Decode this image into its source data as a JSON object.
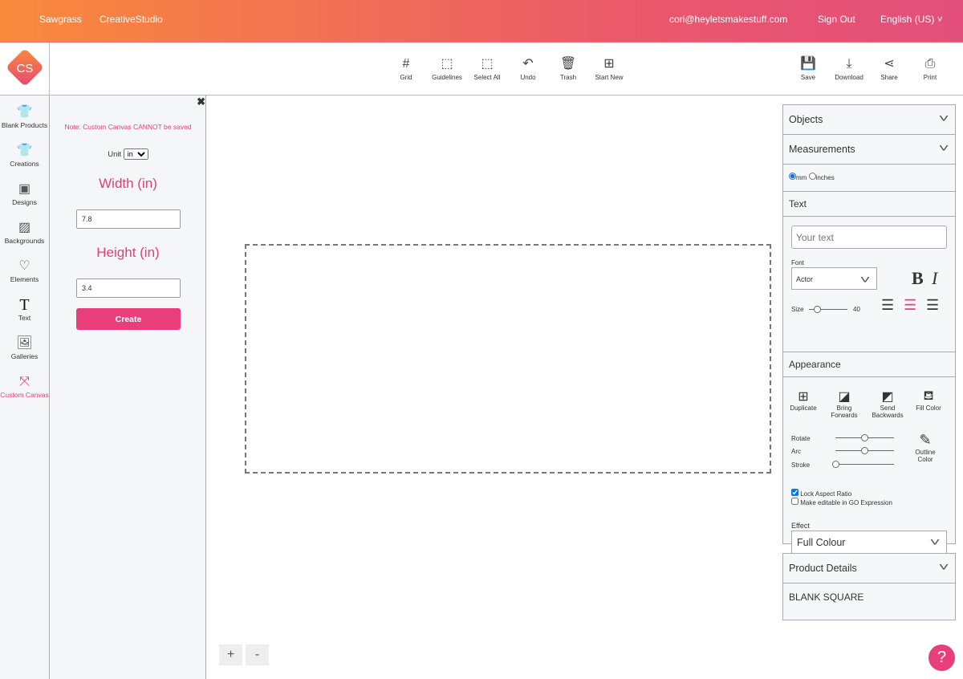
{
  "header": {
    "brand": "Sawgrass",
    "app": "CreativeStudio",
    "email": "cori@heyletsmakestuff.com",
    "sign_out": "Sign Out",
    "language": "English (US)"
  },
  "logo": "CS",
  "toolbar": {
    "center": [
      {
        "icon": "grid-icon",
        "label": "Grid"
      },
      {
        "icon": "guidelines-icon",
        "label": "Guidelines"
      },
      {
        "icon": "select-all-icon",
        "label": "Select All"
      },
      {
        "icon": "undo-icon",
        "label": "Undo"
      },
      {
        "icon": "trash-icon",
        "label": "Trash"
      },
      {
        "icon": "start-new-icon",
        "label": "Start New"
      }
    ],
    "right": [
      {
        "icon": "save-icon",
        "label": "Save"
      },
      {
        "icon": "download-icon",
        "label": "Download"
      },
      {
        "icon": "share-icon",
        "label": "Share"
      },
      {
        "icon": "print-icon",
        "label": "Print"
      }
    ]
  },
  "sidebar": {
    "items": [
      {
        "label": "Blank Products",
        "icon": "tshirt-icon"
      },
      {
        "label": "Creations",
        "icon": "creation-tshirt-icon"
      },
      {
        "label": "Designs",
        "icon": "design-icon"
      },
      {
        "label": "Backgrounds",
        "icon": "background-pattern-icon"
      },
      {
        "label": "Elements",
        "icon": "shapes-icon"
      },
      {
        "label": "Text",
        "icon": "text-icon"
      },
      {
        "label": "Galleries",
        "icon": "image-icon"
      },
      {
        "label": "Custom Canvas",
        "icon": "custom-canvas-icon",
        "active": true
      }
    ]
  },
  "panel": {
    "note": "Note: Custom Canvas CANNOT be saved",
    "unit_label": "Unit",
    "unit_value": "in",
    "width_title": "Width (in)",
    "width_value": "7.8",
    "height_title": "Height (in)",
    "height_value": "3.4",
    "create": "Create"
  },
  "zoom": {
    "plus": "+",
    "minus": "-"
  },
  "right_panel": {
    "objects": "Objects",
    "measurements": "Measurements",
    "mm": "mm",
    "inches": "inches",
    "text_title": "Text",
    "text_placeholder": "Your text",
    "font_label": "Font",
    "font_value": "Actor",
    "bold": "B",
    "italic": "I",
    "size_label": "Size",
    "size_value": "40",
    "appearance": "Appearance",
    "duplicate": "Duplicate",
    "bring_forwards": "Bring Forwards",
    "send_backwards": "Send Backwards",
    "fill_color": "Fill Color",
    "rotate": "Rotate",
    "arc": "Arc",
    "stroke": "Stroke",
    "outline_color": "Outline Color",
    "lock_aspect": "Lock Aspect Ratio",
    "make_editable": "Make editable in GO Expression",
    "effect_label": "Effect",
    "effect_value": "Full Colour",
    "product_details": "Product Details",
    "product_name": "BLANK SQUARE"
  },
  "help": "?",
  "colors": {
    "accent": "#e83e79",
    "header_start": "#f98a3c",
    "header_end": "#e24f7c"
  }
}
